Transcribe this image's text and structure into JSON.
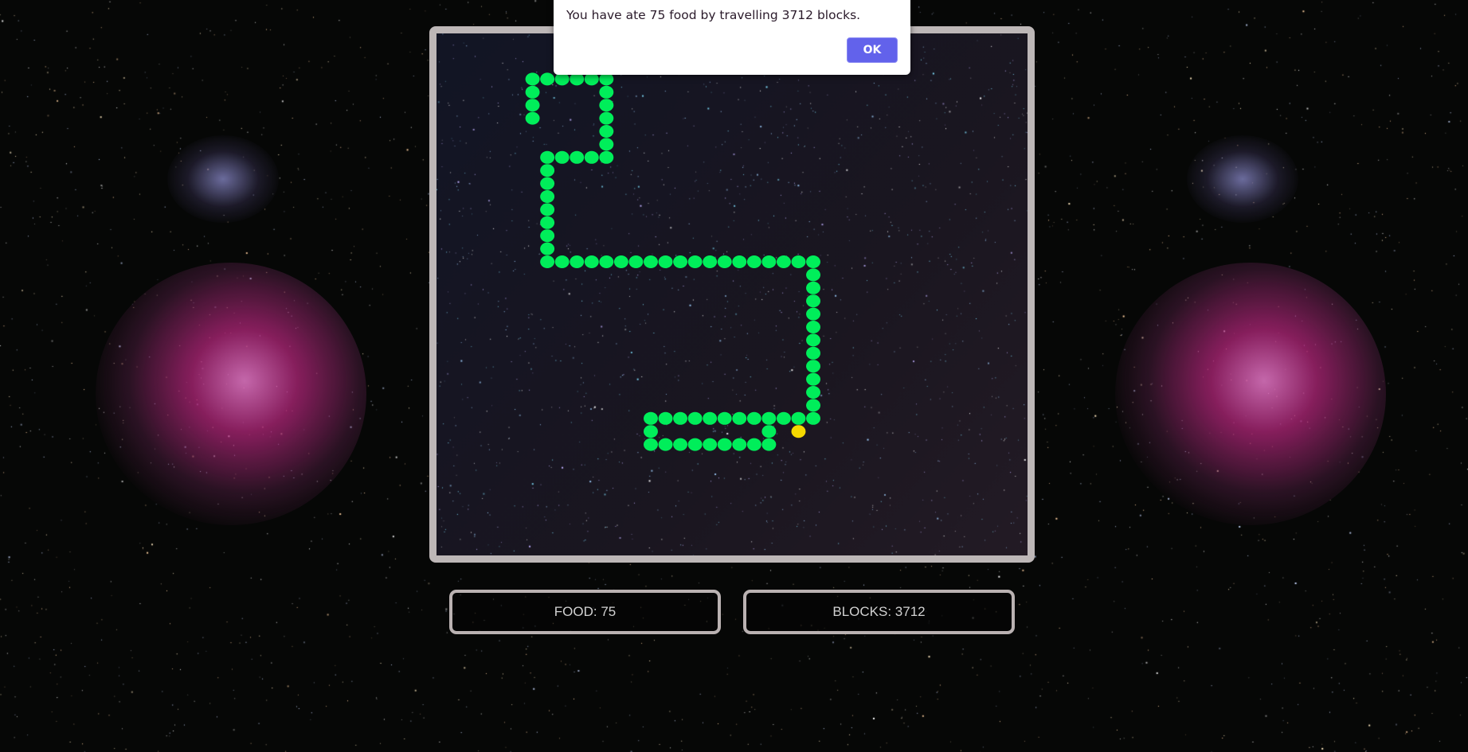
{
  "game": {
    "grid": {
      "cols": 40,
      "rows": 40
    },
    "snake_path": [
      [
        6,
        6
      ],
      [
        6,
        3
      ],
      [
        11,
        3
      ],
      [
        11,
        9
      ],
      [
        7,
        9
      ],
      [
        7,
        17
      ],
      [
        25,
        17
      ],
      [
        25,
        29
      ],
      [
        14,
        29
      ],
      [
        14,
        31
      ],
      [
        22,
        31
      ],
      [
        22,
        30
      ]
    ],
    "food": [
      24,
      30
    ],
    "colors": {
      "snake": "#00ee5a",
      "food": "#f5d800",
      "border": "#bdb7b7"
    }
  },
  "scoreboard": {
    "food_label": "FOOD: 75",
    "blocks_label": "BLOCKS: 3712"
  },
  "dialog": {
    "message": "You have ate 75 food by travelling 3712 blocks.",
    "ok_label": "OK",
    "ok_color": "#6262eb"
  }
}
